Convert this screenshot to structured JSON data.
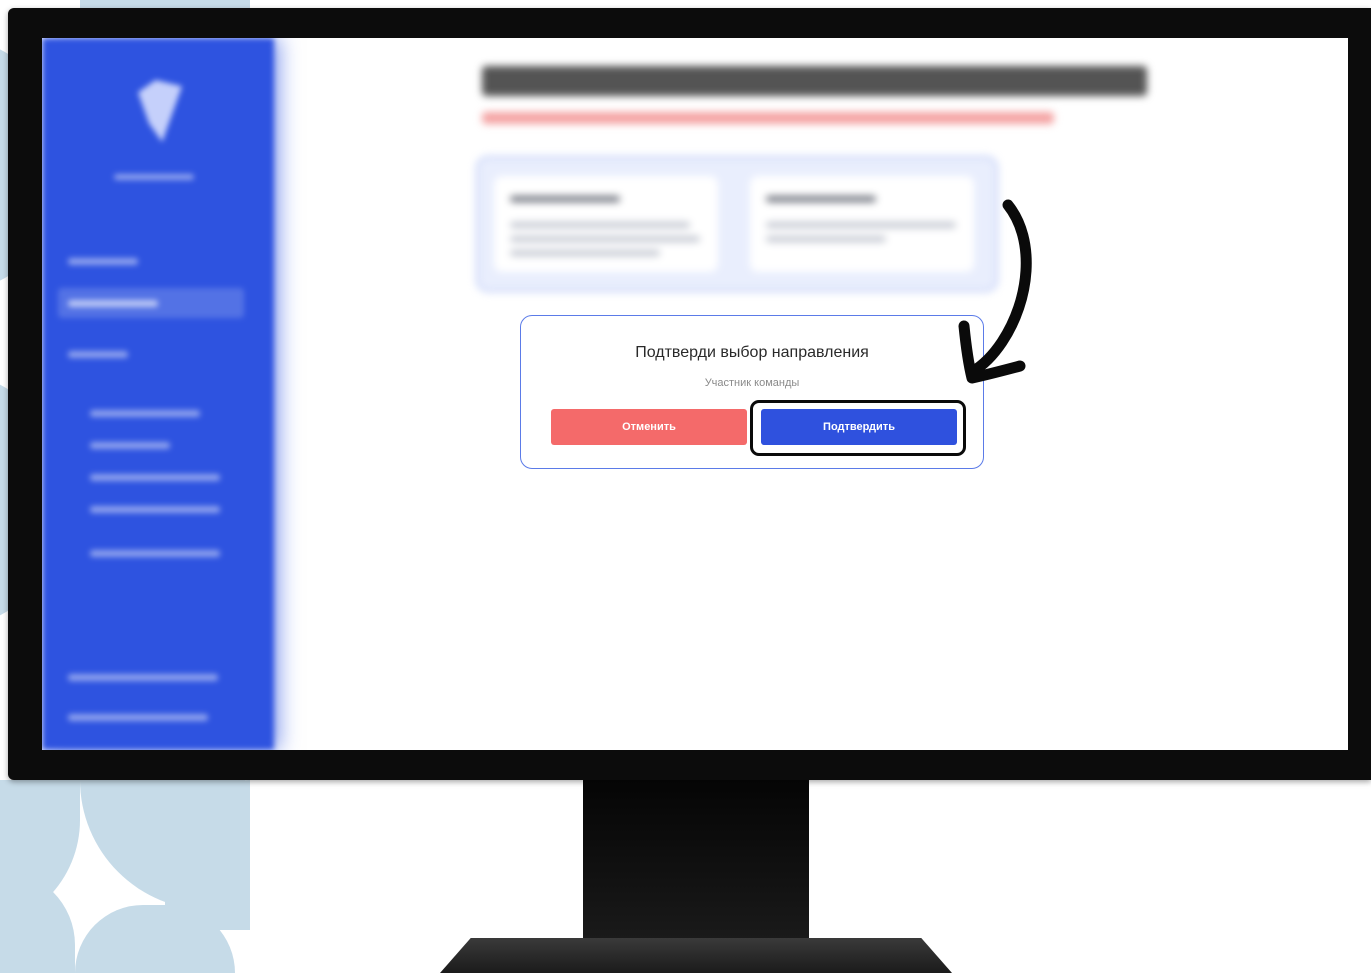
{
  "dialog": {
    "title": "Подтверди выбор направления",
    "subtitle": "Участник команды",
    "cancel_label": "Отменить",
    "confirm_label": "Подтвердить"
  },
  "colors": {
    "sidebar": "#2e53e0",
    "cancel_button": "#f46a6a",
    "confirm_button": "#2f51de",
    "dialog_border": "#5b7be8",
    "background_pattern": "#c6dbe8"
  },
  "icons": {
    "annotation": "curved-arrow-icon",
    "logo": "app-logo-icon"
  }
}
